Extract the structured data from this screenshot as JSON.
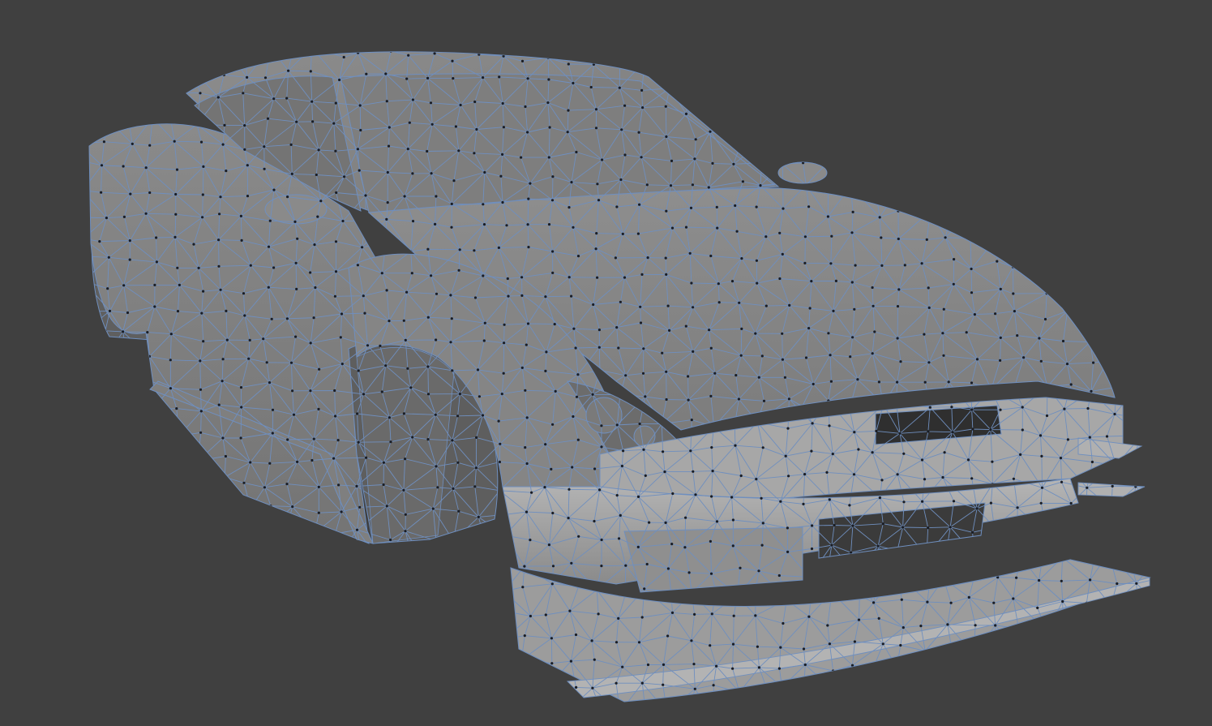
{
  "viewport": {
    "background": "#404040",
    "shading": "solid",
    "mode": "edit-mode-wireframe-overlay"
  },
  "mesh": {
    "object": "car-body",
    "face_color": "#8a8a8a",
    "edge_color": "#6f8fbf",
    "vertex_color": "#1a1d24"
  }
}
